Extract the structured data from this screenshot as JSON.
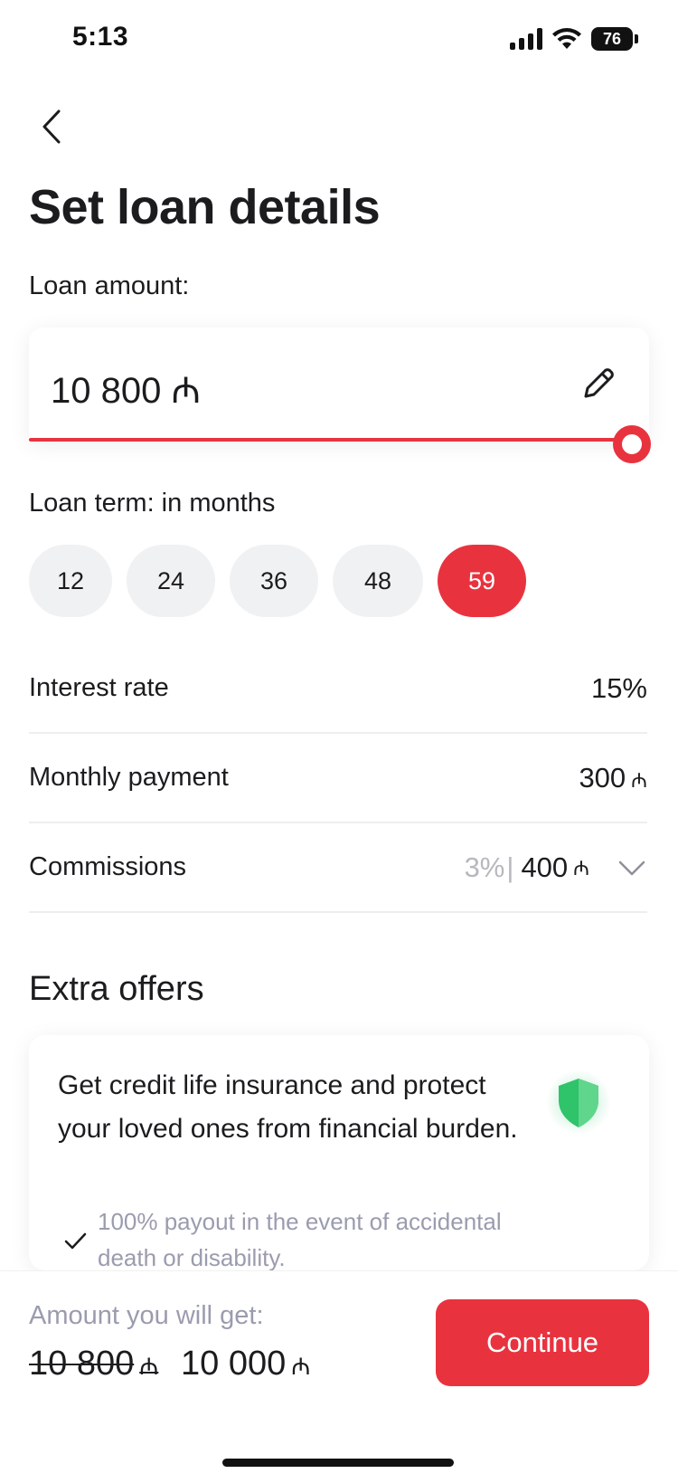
{
  "status_bar": {
    "time": "5:13",
    "battery": "76"
  },
  "header": {
    "title": "Set loan details"
  },
  "loan_amount": {
    "label": "Loan amount:",
    "value": "10 800 ₼",
    "slider_fraction": 1.0
  },
  "loan_term": {
    "label": "Loan term: in months",
    "options": [
      "12",
      "24",
      "36",
      "48",
      "59"
    ],
    "selected": "59"
  },
  "details": {
    "interest_rate": {
      "label": "Interest rate",
      "value": "15%"
    },
    "monthly_payment": {
      "label": "Monthly payment",
      "value": "300",
      "currency": "₼"
    },
    "commissions": {
      "label": "Commissions",
      "percent": "3%",
      "separator": "|",
      "value": "400",
      "currency": "₼"
    }
  },
  "extra_offers": {
    "title": "Extra offers",
    "offer_text": "Get credit life insurance and protect your loved ones from financial burden.",
    "bullet": "100% payout in the event of accidental death or disability."
  },
  "footer": {
    "get_label": "Amount you will get:",
    "old_amount": "10 800",
    "new_amount": "10 000",
    "currency": "₼",
    "continue_label": "Continue"
  },
  "colors": {
    "accent": "#e8333f",
    "chip_bg": "#f0f1f3",
    "muted": "#9a9cae",
    "shield": "#2fc36a"
  }
}
